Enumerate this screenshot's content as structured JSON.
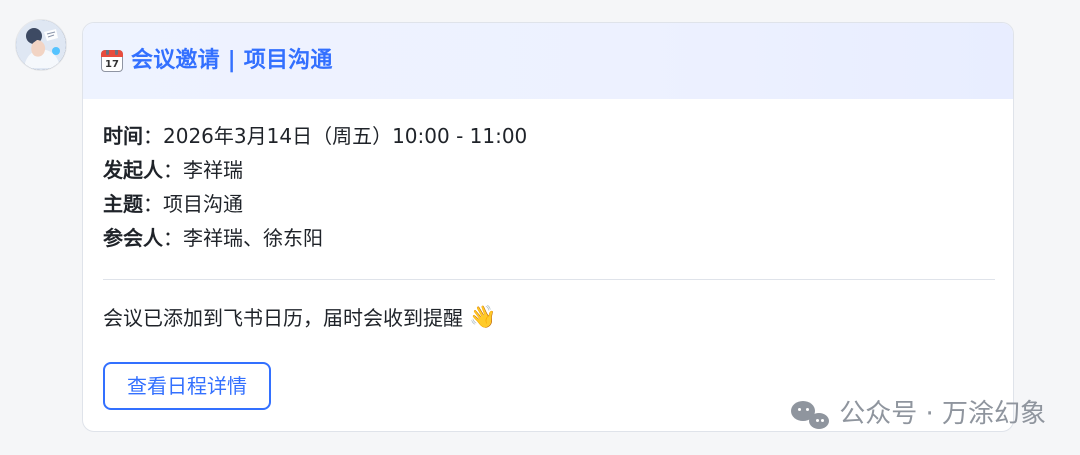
{
  "header": {
    "calendar_day": "17",
    "title": "会议邀请 | 项目沟通"
  },
  "details": [
    {
      "label": "时间",
      "value": "2026年3月14日（周五）10:00 - 11:00"
    },
    {
      "label": "发起人",
      "value": "李祥瑞"
    },
    {
      "label": "主题",
      "value": "项目沟通"
    },
    {
      "label": "参会人",
      "value": "李祥瑞、徐东阳"
    }
  ],
  "note": {
    "text": "会议已添加到飞书日历，届时会收到提醒",
    "icon": "👋"
  },
  "button": {
    "label": "查看日程详情"
  },
  "watermark": {
    "text": "公众号 · 万涂幻象"
  },
  "colors": {
    "accent": "#3370ff",
    "header_bg_start": "#eef3ff",
    "header_bg_end": "#e8edff",
    "border": "#dfe3ea",
    "text": "#1f2329",
    "watermark": "#8f959e"
  },
  "icons": {
    "avatar": "avatar",
    "calendar": "calendar-icon",
    "wave": "wave-icon",
    "wechat": "wechat-icon"
  }
}
